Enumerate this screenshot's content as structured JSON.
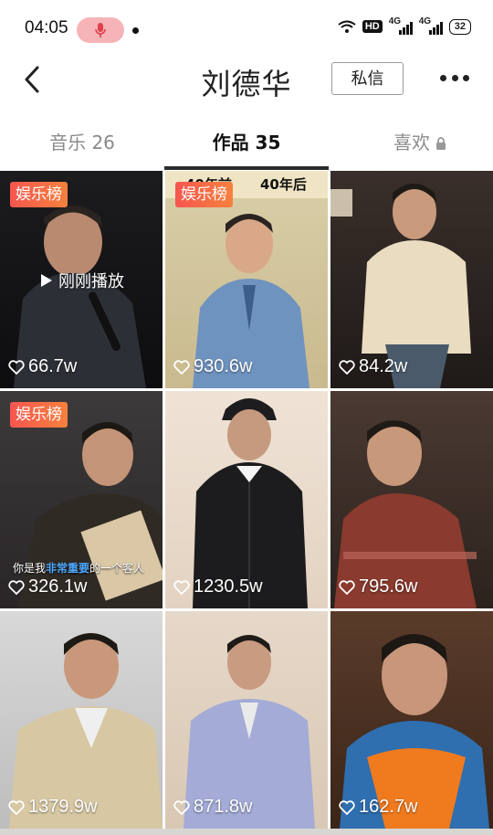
{
  "status_bar": {
    "time": "04:05",
    "hd": "HD",
    "net1": "4G",
    "net2": "4G",
    "battery": "32"
  },
  "header": {
    "title": "刘德华",
    "message_button": "私信"
  },
  "tabs": [
    {
      "label": "音乐 26",
      "active": false
    },
    {
      "label": "作品 35",
      "active": true
    },
    {
      "label": "喜欢",
      "active": false,
      "locked": true
    }
  ],
  "videos": [
    {
      "count": "66.7w",
      "badge": "娱乐榜",
      "overlay": "刚刚播放"
    },
    {
      "count": "930.6w",
      "badge": "娱乐榜",
      "caption_left": "40年前",
      "caption_right": "40年后"
    },
    {
      "count": "84.2w"
    },
    {
      "count": "326.1w",
      "badge": "娱乐榜",
      "subtitle_pre": "你是我",
      "subtitle_hl": "非常重要",
      "subtitle_post": "的一个客人"
    },
    {
      "count": "1230.5w"
    },
    {
      "count": "795.6w"
    },
    {
      "count": "1379.9w"
    },
    {
      "count": "871.8w"
    },
    {
      "count": "162.7w"
    }
  ],
  "colors": {
    "accent_badge": "#f6564f",
    "tab_active": "#111111",
    "tab_inactive": "#8a8a8a"
  }
}
